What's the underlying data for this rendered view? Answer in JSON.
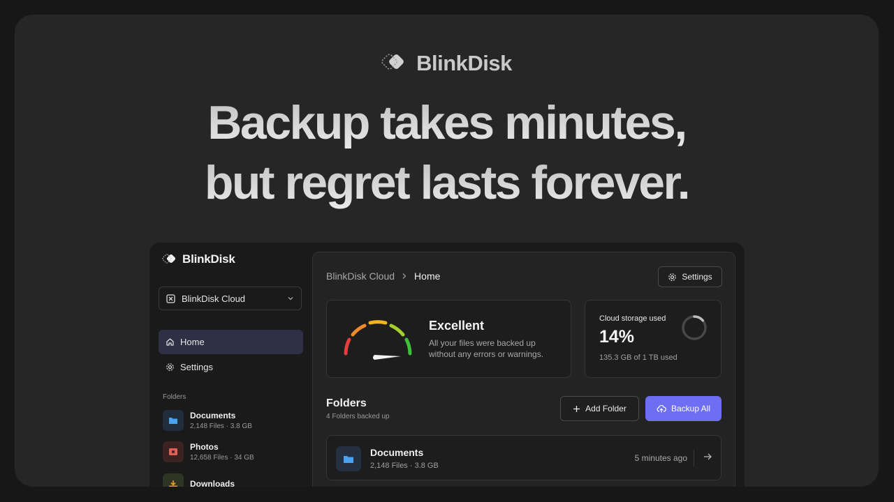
{
  "hero": {
    "brand": "BlinkDisk",
    "headline_line1": "Backup takes minutes,",
    "headline_line2": "but regret lasts forever."
  },
  "sidebar": {
    "brand": "BlinkDisk",
    "drive_selector": "BlinkDisk Cloud",
    "nav": [
      {
        "label": "Home",
        "icon": "home-icon",
        "active": true
      },
      {
        "label": "Settings",
        "icon": "gear-icon",
        "active": false
      }
    ],
    "folders_label": "Folders",
    "folders": [
      {
        "name": "Documents",
        "meta": "2,148 Files · 3.8 GB",
        "icon": "folder-icon",
        "color": "#4aa3f0"
      },
      {
        "name": "Photos",
        "meta": "12,658 Files · 34 GB",
        "icon": "photo-icon",
        "color": "#e0605a"
      },
      {
        "name": "Downloads",
        "meta": "",
        "icon": "download-icon",
        "color": "#e0a030"
      }
    ]
  },
  "main": {
    "breadcrumb": [
      "BlinkDisk Cloud",
      "Home"
    ],
    "settings_button": "Settings",
    "status": {
      "title": "Excellent",
      "description": "All your files were backed up without any errors or warnings."
    },
    "storage": {
      "label": "Cloud storage used",
      "percent_text": "14%",
      "fraction": 0.14,
      "detail": "135.3 GB of 1 TB used"
    },
    "folders_title": "Folders",
    "folders_subtitle": "4 Folders backed up",
    "add_folder_button": "Add Folder",
    "backup_all_button": "Backup All",
    "rows": [
      {
        "name": "Documents",
        "meta": "2,148 Files · 3.8 GB",
        "time": "5 minutes ago"
      }
    ]
  },
  "colors": {
    "accent": "#6e6ef2",
    "active_nav": "#2f2f45",
    "gauge": [
      "#e0413e",
      "#ef8a2b",
      "#f2b321",
      "#a5cf2e",
      "#3fbf3a"
    ]
  }
}
